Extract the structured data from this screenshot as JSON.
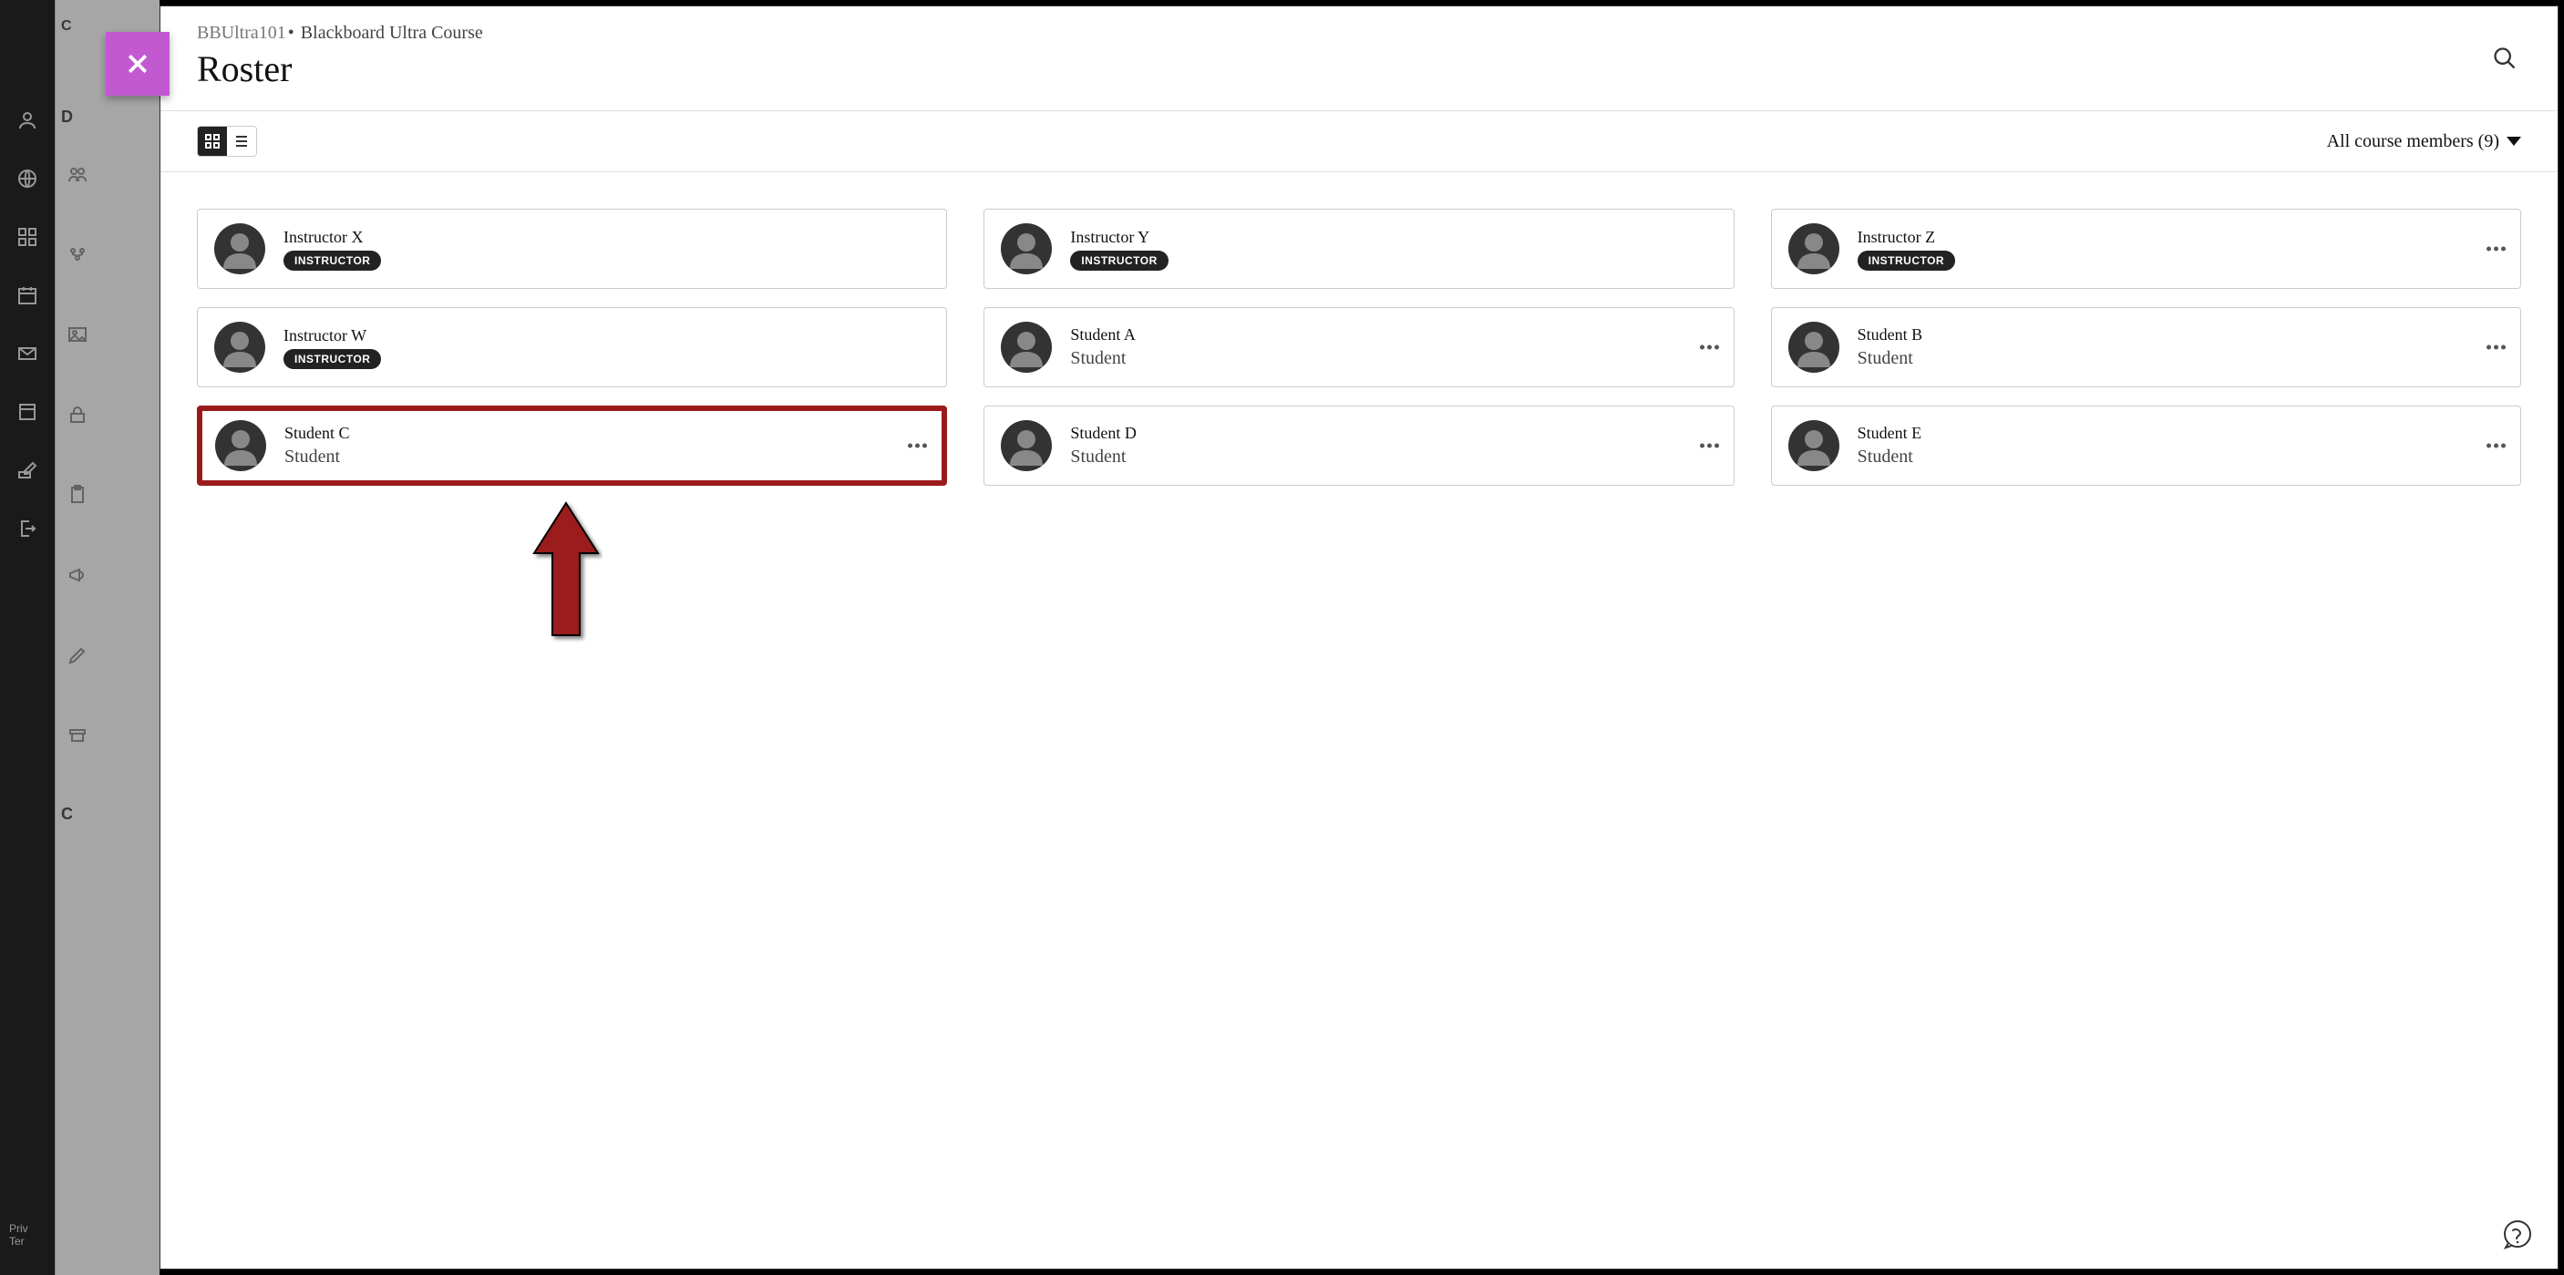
{
  "breadcrumb": {
    "course_id": "BBUltra101",
    "course_name": "Blackboard Ultra Course"
  },
  "page_title": "Roster",
  "filter": {
    "label": "All course members (9)"
  },
  "under_panel": {
    "top_label": "C",
    "section_d": "D",
    "section_c": "C"
  },
  "sidebar_footer": {
    "line1": "Priv",
    "line2": "Ter"
  },
  "members": [
    {
      "name": "Instructor X",
      "role": "INSTRUCTOR",
      "is_instructor": true,
      "show_menu": false,
      "highlighted": false
    },
    {
      "name": "Instructor Y",
      "role": "INSTRUCTOR",
      "is_instructor": true,
      "show_menu": false,
      "highlighted": false
    },
    {
      "name": "Instructor Z",
      "role": "INSTRUCTOR",
      "is_instructor": true,
      "show_menu": true,
      "highlighted": false
    },
    {
      "name": "Instructor W",
      "role": "INSTRUCTOR",
      "is_instructor": true,
      "show_menu": false,
      "highlighted": false
    },
    {
      "name": "Student A",
      "role": "Student",
      "is_instructor": false,
      "show_menu": true,
      "highlighted": false
    },
    {
      "name": "Student B",
      "role": "Student",
      "is_instructor": false,
      "show_menu": true,
      "highlighted": false
    },
    {
      "name": "Student C",
      "role": "Student",
      "is_instructor": false,
      "show_menu": true,
      "highlighted": true
    },
    {
      "name": "Student D",
      "role": "Student",
      "is_instructor": false,
      "show_menu": true,
      "highlighted": false
    },
    {
      "name": "Student E",
      "role": "Student",
      "is_instructor": false,
      "show_menu": true,
      "highlighted": false
    }
  ]
}
